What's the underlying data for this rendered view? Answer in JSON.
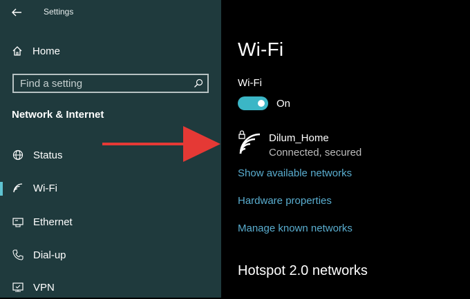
{
  "window": {
    "title": "Settings"
  },
  "sidebar": {
    "home_label": "Home",
    "search_placeholder": "Find a setting",
    "section_heading": "Network & Internet",
    "items": [
      {
        "label": "Status",
        "icon": "globe-icon"
      },
      {
        "label": "Wi-Fi",
        "icon": "wifi-icon",
        "active": true
      },
      {
        "label": "Ethernet",
        "icon": "ethernet-icon"
      },
      {
        "label": "Dial-up",
        "icon": "phone-icon"
      },
      {
        "label": "VPN",
        "icon": "vpn-icon"
      }
    ]
  },
  "main": {
    "page_title": "Wi-Fi",
    "wifi_toggle_label": "Wi-Fi",
    "wifi_toggle_state": "On",
    "network": {
      "name": "Dilum_Home",
      "status": "Connected, secured"
    },
    "links": [
      "Show available networks",
      "Hardware properties",
      "Manage known networks"
    ],
    "section_heading": "Hotspot 2.0 networks"
  },
  "colors": {
    "sidebar_bg": "#1f3a3d",
    "main_bg": "#000000",
    "accent": "#3bb6c6",
    "link": "#5aaed0",
    "annotation_arrow": "#e53935"
  }
}
